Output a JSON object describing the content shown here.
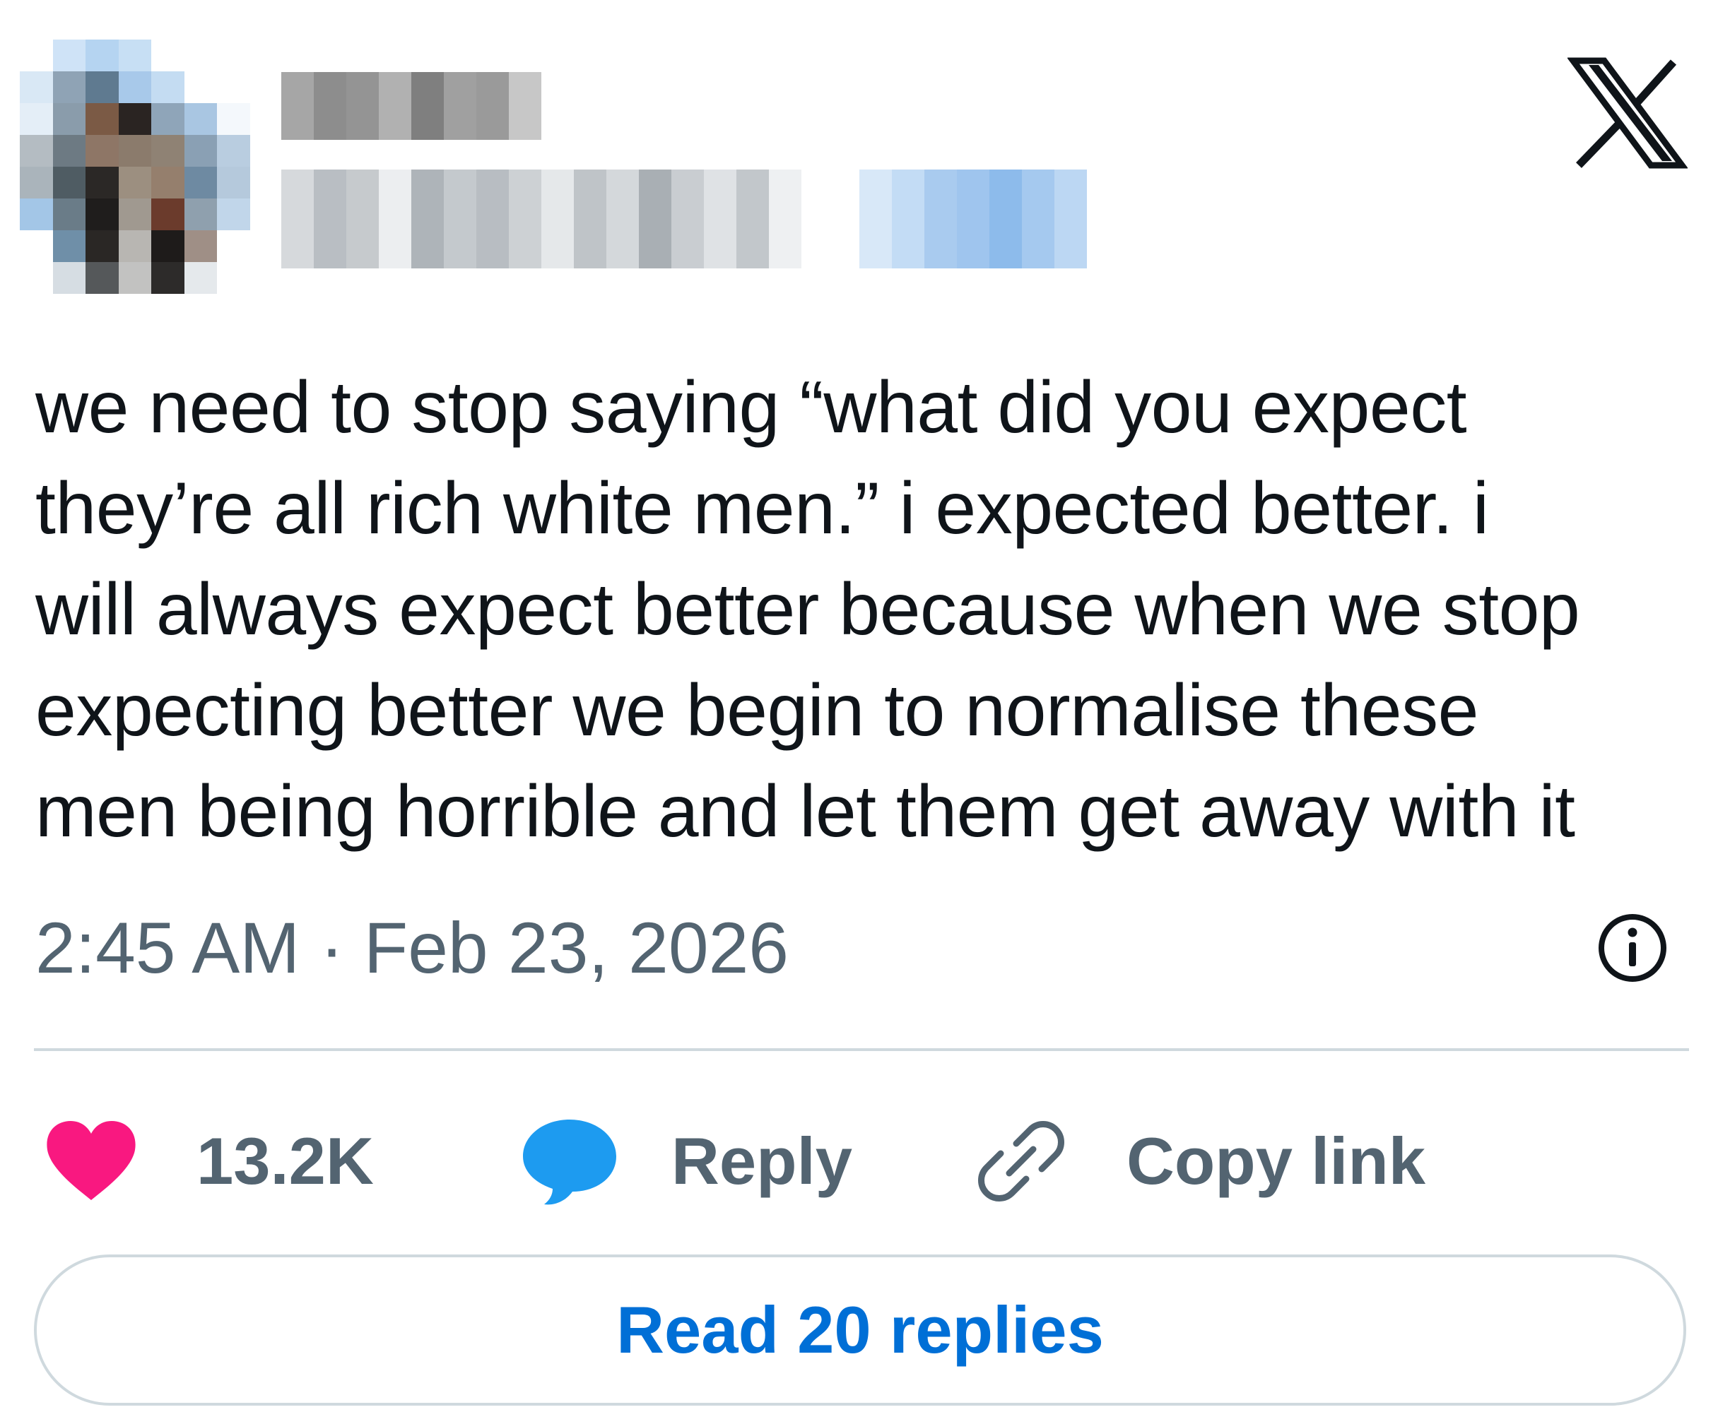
{
  "author": {
    "avatar_alt": "profile picture (pixelated)",
    "name_alt": "display name (pixelated)",
    "handle_alt": "username (pixelated)",
    "follow_alt": "Follow (pixelated)"
  },
  "brand": {
    "logo_icon": "x-logo-icon",
    "logo_color": "#0f1419"
  },
  "tweet": {
    "text_lines": [
      "we need to stop saying “what did you expect",
      "they’re all rich white men.” i expected better. i",
      "will always expect better because when we stop",
      "expecting better we begin to normalise these",
      "men being horrible and let them get away with it"
    ],
    "time": "2:45 AM",
    "separator": " · ",
    "date": "Feb 23, 2026",
    "info_icon": "info-icon"
  },
  "actions": {
    "like": {
      "icon": "heart-icon",
      "count": "13.2K",
      "color": "#f91880"
    },
    "reply": {
      "icon": "speech-bubble-icon",
      "label": "Reply",
      "color": "#1d9bf0"
    },
    "copy": {
      "icon": "link-icon",
      "label": "Copy link"
    }
  },
  "read_replies": {
    "label": "Read 20 replies",
    "color": "#006fd6"
  }
}
